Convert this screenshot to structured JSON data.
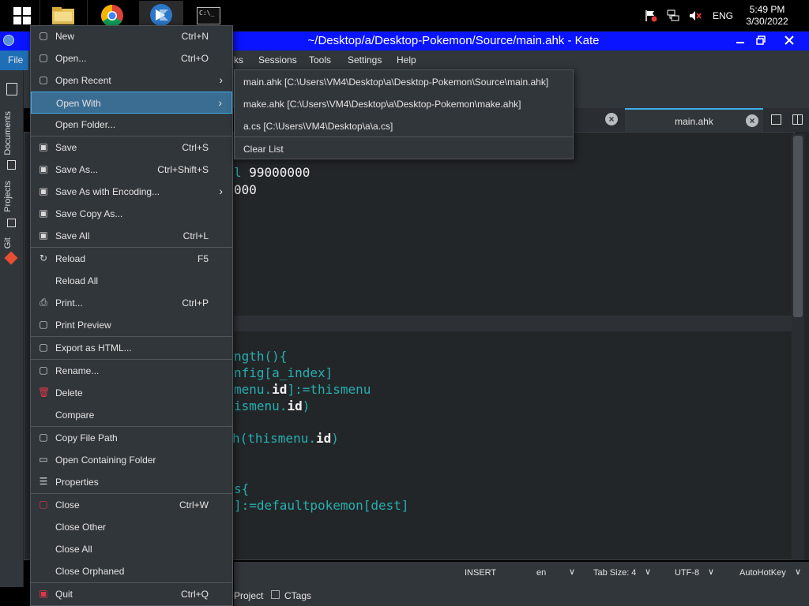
{
  "taskbar": {
    "apps": [
      {
        "name": "file-explorer"
      },
      {
        "name": "chrome"
      },
      {
        "name": "kate",
        "active": true
      },
      {
        "name": "terminal",
        "label": "C:\\_"
      }
    ],
    "lang": "ENG",
    "time": "5:49 PM",
    "date": "3/30/2022"
  },
  "window": {
    "title": "~/Desktop/a/Desktop-Pokemon/Source/main.ahk  - Kate"
  },
  "menubar": {
    "items": [
      "File",
      "ks",
      "Sessions",
      "Tools",
      "Settings",
      "Help"
    ]
  },
  "sidebar": {
    "tabs": [
      "Documents",
      "Projects",
      "Git"
    ]
  },
  "tabs": {
    "active": "main.ahk"
  },
  "code": {
    "lines": [
      {
        "parts": [
          {
            "t": "l ",
            "c": "c-green"
          },
          {
            "t": "99000000",
            "c": "c-num"
          }
        ]
      },
      {
        "parts": [
          {
            "t": "000",
            "c": "c-num"
          }
        ]
      },
      {
        "parts": [
          {
            "t": "ngth(){",
            "c": "c-green"
          }
        ]
      },
      {
        "parts": [
          {
            "t": "nfig[a_index]",
            "c": "c-green"
          }
        ]
      },
      {
        "parts": [
          {
            "t": "menu.",
            "c": "c-green"
          },
          {
            "t": "id",
            "c": "c-bold"
          },
          {
            "t": "]:=thismenu",
            "c": "c-green"
          }
        ]
      },
      {
        "parts": [
          {
            "t": "ismenu.",
            "c": "c-green"
          },
          {
            "t": "id",
            "c": "c-bold"
          },
          {
            "t": ")",
            "c": "c-green"
          }
        ]
      },
      {
        "parts": [
          {
            "t": "h(thismenu.",
            "c": "c-green"
          },
          {
            "t": "id",
            "c": "c-bold"
          },
          {
            "t": ")",
            "c": "c-green"
          }
        ]
      },
      {
        "parts": [
          {
            "t": "s{",
            "c": "c-green"
          }
        ]
      },
      {
        "parts": [
          {
            "t": "]:=defaultpokemon[dest]",
            "c": "c-green"
          }
        ]
      }
    ]
  },
  "statusbar": {
    "mode": "INSERT",
    "lang": "en",
    "tab_size": "Tab Size: 4",
    "encoding": "UTF-8",
    "syntax": "AutoHotKey"
  },
  "bottom_panel": {
    "project": "Project",
    "ctags": "CTags"
  },
  "file_menu": {
    "items": [
      {
        "label": "New",
        "shortcut": "Ctrl+N",
        "icon": "new-file-icon"
      },
      {
        "label": "Open...",
        "shortcut": "Ctrl+O",
        "icon": "open-file-icon"
      },
      {
        "label": "Open Recent",
        "shortcut": "",
        "icon": "open-recent-icon",
        "submenu": true
      },
      {
        "label": "Open With",
        "shortcut": "",
        "icon": "",
        "submenu": true,
        "highlighted": true
      },
      {
        "label": "Open Folder...",
        "shortcut": "",
        "icon": ""
      },
      {
        "label": "Save",
        "shortcut": "Ctrl+S",
        "icon": "save-icon"
      },
      {
        "label": "Save As...",
        "shortcut": "Ctrl+Shift+S",
        "icon": "save-as-icon"
      },
      {
        "label": "Save As with Encoding...",
        "shortcut": "",
        "icon": "save-as-encoding-icon",
        "submenu": true
      },
      {
        "label": "Save Copy As...",
        "shortcut": "",
        "icon": "save-copy-icon"
      },
      {
        "label": "Save All",
        "shortcut": "Ctrl+L",
        "icon": "save-all-icon"
      },
      {
        "label": "Reload",
        "shortcut": "F5",
        "icon": "reload-icon"
      },
      {
        "label": "Reload All",
        "shortcut": "",
        "icon": ""
      },
      {
        "label": "Print...",
        "shortcut": "Ctrl+P",
        "icon": "print-icon"
      },
      {
        "label": "Print Preview",
        "shortcut": "",
        "icon": "print-preview-icon"
      },
      {
        "label": "Export as HTML...",
        "shortcut": "",
        "icon": "export-icon"
      },
      {
        "label": "Rename...",
        "shortcut": "",
        "icon": "rename-icon"
      },
      {
        "label": "Delete",
        "shortcut": "",
        "icon": "delete-icon"
      },
      {
        "label": "Compare",
        "shortcut": "",
        "icon": ""
      },
      {
        "label": "Copy File Path",
        "shortcut": "",
        "icon": "copy-icon"
      },
      {
        "label": "Open Containing Folder",
        "shortcut": "",
        "icon": "folder-icon"
      },
      {
        "label": "Properties",
        "shortcut": "",
        "icon": "properties-icon"
      },
      {
        "label": "Close",
        "shortcut": "Ctrl+W",
        "icon": "close-doc-icon"
      },
      {
        "label": "Close Other",
        "shortcut": "",
        "icon": ""
      },
      {
        "label": "Close All",
        "shortcut": "",
        "icon": ""
      },
      {
        "label": "Close Orphaned",
        "shortcut": "",
        "icon": ""
      },
      {
        "label": "Quit",
        "shortcut": "Ctrl+Q",
        "icon": "quit-icon"
      }
    ]
  },
  "open_with_submenu": {
    "items": [
      "main.ahk [C:\\Users\\VM4\\Desktop\\a\\Desktop-Pokemon\\Source\\main.ahk]",
      "make.ahk [C:\\Users\\VM4\\Desktop\\a\\Desktop-Pokemon\\make.ahk]",
      "a.cs [C:\\Users\\VM4\\Desktop\\a\\a.cs]",
      "Clear List"
    ]
  },
  "colors": {
    "accent": "#3daee9",
    "titlebar": "#0a14ff",
    "menu_bg": "#31363b",
    "highlight": "#3b6d92",
    "code_green": "#27aeae"
  }
}
